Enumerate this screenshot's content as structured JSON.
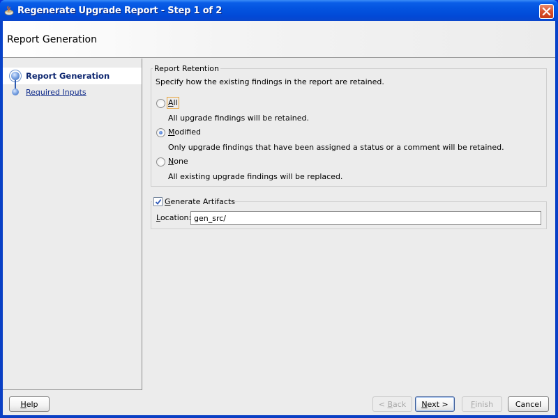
{
  "window": {
    "title": "Regenerate Upgrade Report - Step 1 of 2",
    "app_icon": "java-cup-icon",
    "close_icon": "close-icon"
  },
  "header": {
    "title": "Report Generation"
  },
  "nav": {
    "items": [
      {
        "label": "Report Generation",
        "state": "current",
        "icon": "step-bullet-icon"
      },
      {
        "label": "Required Inputs",
        "state": "link",
        "icon": "step-bullet-icon"
      }
    ]
  },
  "report_retention": {
    "group_title": "Report Retention",
    "description": "Specify how the existing findings in the report are retained.",
    "options": [
      {
        "label": "All",
        "mnemonic": "A",
        "rest": "ll",
        "description": "All upgrade findings will be retained.",
        "selected": false,
        "focused": true
      },
      {
        "label": "Modified",
        "mnemonic": "M",
        "rest": "odified",
        "description": "Only upgrade findings that have been assigned a status or a comment will be retained.",
        "selected": true,
        "focused": false
      },
      {
        "label": "None",
        "mnemonic": "N",
        "rest": "one",
        "description": "All existing upgrade findings will be replaced.",
        "selected": false,
        "focused": false
      }
    ]
  },
  "generate_artifacts": {
    "label_mnemonic": "G",
    "label_rest": "enerate Artifacts",
    "checked": true,
    "location_label_mnemonic": "L",
    "location_label_rest": "ocation:",
    "location_value": "gen_src/"
  },
  "footer": {
    "help": {
      "mnemonic": "H",
      "rest": "elp"
    },
    "back": {
      "prefix": "< ",
      "mnemonic": "B",
      "rest": "ack",
      "enabled": false
    },
    "next": {
      "mnemonic": "N",
      "rest": "ext >",
      "enabled": true
    },
    "finish": {
      "mnemonic": "F",
      "rest": "inish",
      "enabled": false
    },
    "cancel": {
      "label": "Cancel",
      "enabled": true
    }
  }
}
